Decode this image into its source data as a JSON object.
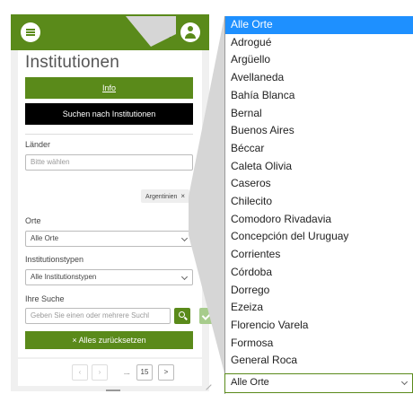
{
  "header": {
    "menu_icon": "menu-icon",
    "user_icon": "user-icon",
    "select_icon": "selection-icon"
  },
  "page": {
    "title": "Institutionen"
  },
  "buttons": {
    "info": "Info",
    "search": "Suchen nach Institutionen",
    "reset": "× Alles zurücksetzen"
  },
  "filters": {
    "countries": {
      "label": "Länder",
      "placeholder": "Bitte wählen",
      "clear": "×",
      "selected_tag": "Argentinien",
      "tag_remove": "×"
    },
    "places": {
      "label": "Orte",
      "value": "Alle Orte"
    },
    "types": {
      "label": "Institutionstypen",
      "value": "Alle Institutionstypen"
    },
    "search": {
      "label": "Ihre Suche",
      "placeholder": "Geben Sie einen oder mehrere Suchl"
    }
  },
  "pager": {
    "prev": "<",
    "next": ">",
    "page2": ">",
    "ellipsis": "...",
    "last": "15",
    "next_btn": ">"
  },
  "dropdown": {
    "options": [
      "Alle Orte",
      "Adrogué",
      "Argüello",
      "Avellaneda",
      "Bahía Blanca",
      "Bernal",
      "Buenos Aires",
      "Béccar",
      "Caleta Olivia",
      "Caseros",
      "Chilecito",
      "Comodoro Rivadavia",
      "Concepción del Uruguay",
      "Corrientes",
      "Córdoba",
      "Dorrego",
      "Ezeiza",
      "Florencio Varela",
      "Formosa",
      "General Roca"
    ],
    "selected_index": 0,
    "current_value": "Alle Orte"
  },
  "colors": {
    "brand_green": "#5a8a1a",
    "highlight": "#1e90ff"
  }
}
